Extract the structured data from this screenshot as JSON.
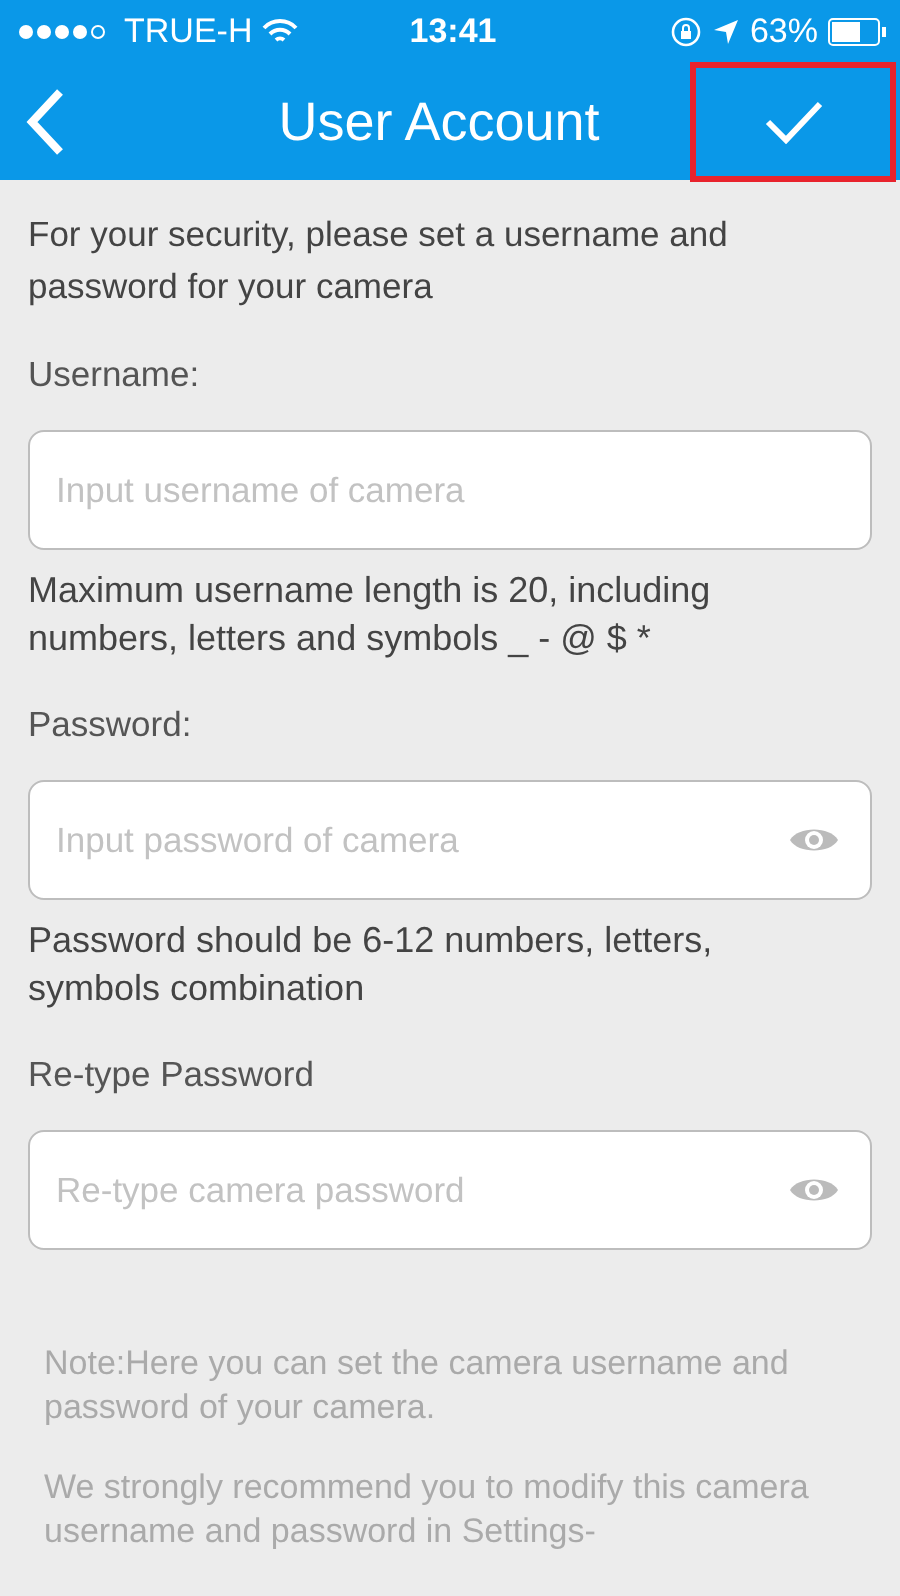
{
  "status_bar": {
    "carrier": "TRUE-H",
    "time": "13:41",
    "battery": "63%"
  },
  "nav": {
    "title": "User Account",
    "done_highlighted": true
  },
  "intro": "For your security, please set a username and password for your camera",
  "fields": [
    {
      "label": "Username:",
      "placeholder": "Input username of camera",
      "kind": "text",
      "hint": "Maximum username length is 20, including numbers, letters and symbols _ - @ $ *"
    },
    {
      "label": "Password:",
      "placeholder": "Input password of camera",
      "kind": "password",
      "hint": "Password should be 6-12 numbers, letters, symbols combination"
    },
    {
      "label": "Re-type Password",
      "placeholder": "Re-type camera password",
      "kind": "password"
    }
  ],
  "notes": [
    "Note:Here you can set the camera username and password of your camera.",
    "We strongly recommend you to modify this camera username and password in Settings-"
  ]
}
